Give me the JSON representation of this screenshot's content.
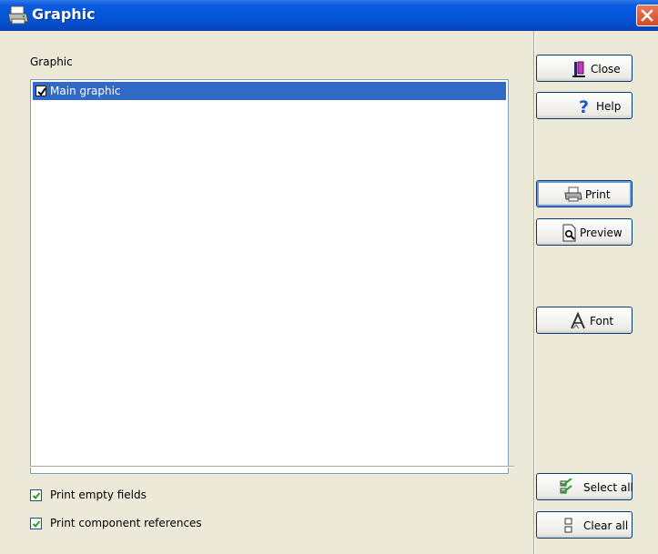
{
  "window": {
    "title": "Graphic",
    "title_icon": "printer-icon",
    "close_icon": "close-icon"
  },
  "left": {
    "group_label": "Graphic",
    "list_items": [
      {
        "label": "Main graphic",
        "checked": true,
        "selected": true
      }
    ],
    "options": [
      {
        "label": "Print empty fields",
        "checked": true
      },
      {
        "label": "Print component references",
        "checked": true
      }
    ]
  },
  "buttons": {
    "close": "Close",
    "help": "Help",
    "print": "Print",
    "preview": "Preview",
    "font": "Font",
    "select_all": "Select all",
    "clear_all": "Clear all"
  },
  "colors": {
    "titlebar": "#0355d6",
    "selection": "#316ac5",
    "close_button": "#d34a25"
  }
}
